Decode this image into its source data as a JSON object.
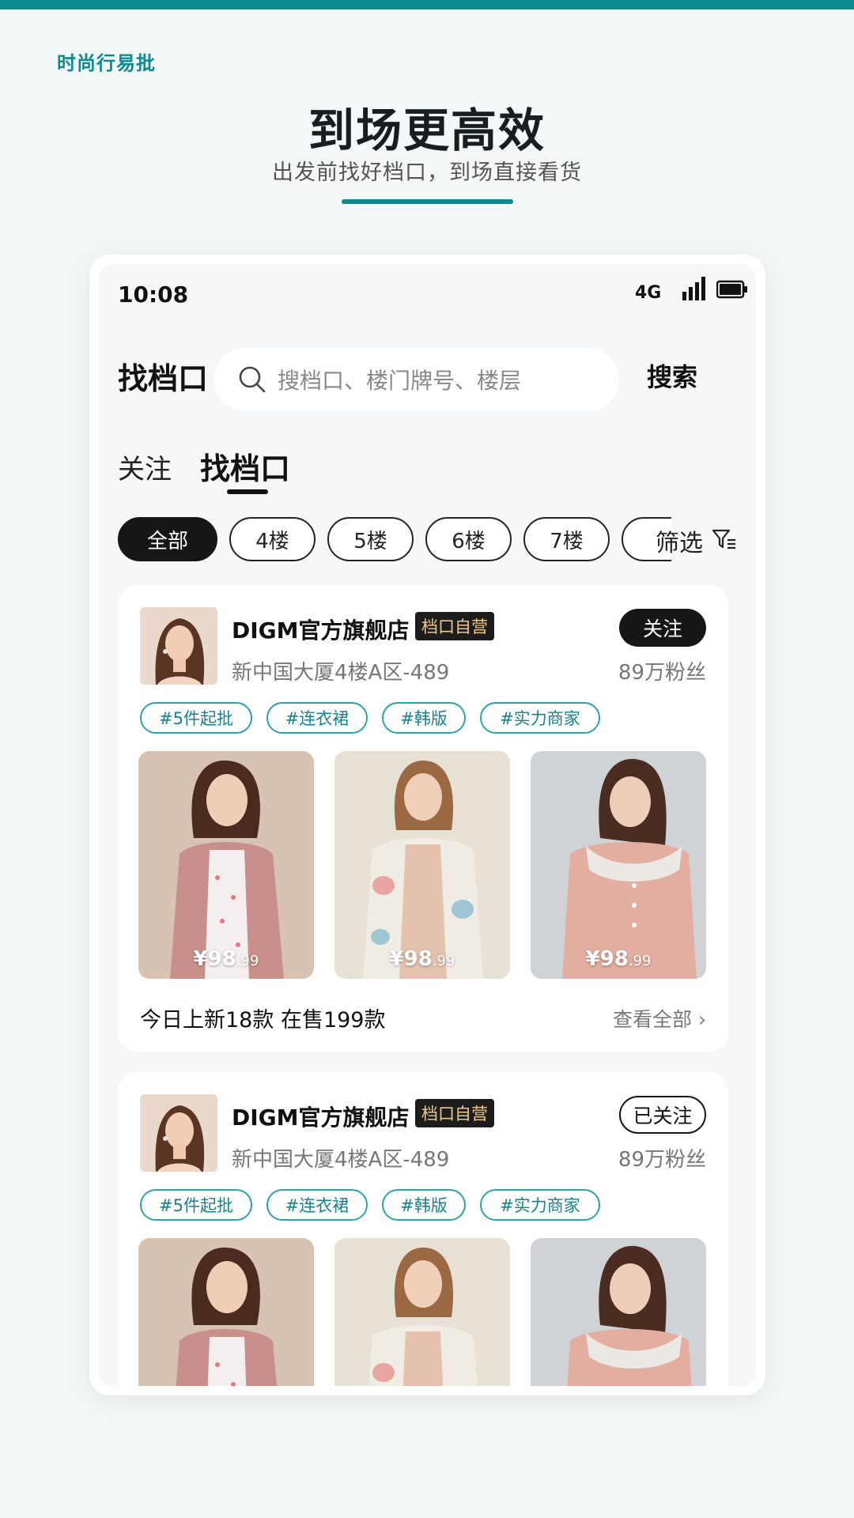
{
  "brand": "时尚行易批",
  "hero": {
    "title": "到场更高效",
    "subtitle": "出发前找好档口，到场直接看货"
  },
  "status_bar": {
    "time": "10:08",
    "network": "4G"
  },
  "header": {
    "title": "找档口",
    "search_placeholder": "搜档口、楼门牌号、楼层",
    "search_button": "搜索"
  },
  "tabs": [
    {
      "label": "关注",
      "active": false
    },
    {
      "label": "找档口",
      "active": true
    }
  ],
  "floor_chips": [
    {
      "label": "全部",
      "active": true
    },
    {
      "label": "4楼",
      "active": false
    },
    {
      "label": "5楼",
      "active": false
    },
    {
      "label": "6楼",
      "active": false
    },
    {
      "label": "7楼",
      "active": false
    }
  ],
  "filter_label": "筛选",
  "stores": [
    {
      "name": "DIGM官方旗舰店",
      "badge": "档口自营",
      "address": "新中国大厦4楼A区-489",
      "fans": "89万粉丝",
      "follow_label": "关注",
      "followed": false,
      "tags": [
        "#5件起批",
        "#连衣裙",
        "#韩版",
        "#实力商家"
      ],
      "products": [
        {
          "currency": "¥",
          "price_int": "98",
          "price_dec": ".99"
        },
        {
          "currency": "¥",
          "price_int": "98",
          "price_dec": ".99"
        },
        {
          "currency": "¥",
          "price_int": "98",
          "price_dec": ".99"
        }
      ],
      "summary": "今日上新18款  在售199款",
      "view_all": "查看全部"
    },
    {
      "name": "DIGM官方旗舰店",
      "badge": "档口自营",
      "address": "新中国大厦4楼A区-489",
      "fans": "89万粉丝",
      "follow_label": "已关注",
      "followed": true,
      "tags": [
        "#5件起批",
        "#连衣裙",
        "#韩版",
        "#实力商家"
      ]
    }
  ],
  "colors": {
    "accent": "#0e8a93",
    "badge_bg": "#1d1d1d",
    "badge_text": "#f0c98a"
  }
}
